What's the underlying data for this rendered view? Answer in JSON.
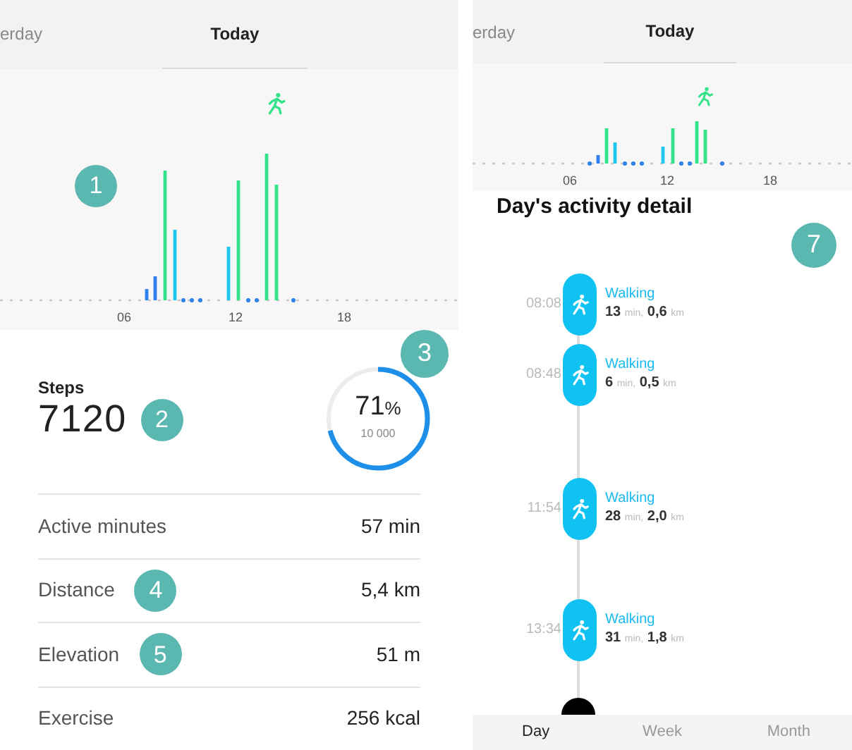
{
  "left": {
    "tabs": [
      {
        "label": "erday",
        "selected": false
      },
      {
        "label": "Today",
        "selected": true
      }
    ],
    "chart": {
      "axis_labels": [
        "06",
        "12",
        "18"
      ]
    },
    "badge_chart": "1",
    "steps": {
      "label": "Steps",
      "value": "7120",
      "badge": "2"
    },
    "goal": {
      "percent": "71",
      "unit": "%",
      "target": "10 000",
      "level": 0.71,
      "badge": "3"
    },
    "stats": [
      {
        "label": "Active minutes",
        "value": "57 min"
      },
      {
        "label": "Distance",
        "value": "5,4 km",
        "badge": "4"
      },
      {
        "label": "Elevation",
        "value": "51 m",
        "badge": "5"
      },
      {
        "label": "Exercise",
        "value": "256 kcal"
      }
    ]
  },
  "right": {
    "tabs": [
      {
        "label": "erday",
        "selected": false
      },
      {
        "label": "Today",
        "selected": true
      }
    ],
    "chart": {
      "axis_labels": [
        "06",
        "12",
        "18"
      ]
    },
    "title": "Day's activity detail",
    "badge": "7",
    "activities": [
      {
        "time": "08:08",
        "type": "Walking",
        "minutes": "13",
        "min_unit": "min,",
        "distance": "0,6",
        "km_unit": "km"
      },
      {
        "time": "08:48",
        "type": "Walking",
        "minutes": "6",
        "min_unit": "min,",
        "distance": "0,5",
        "km_unit": "km"
      },
      {
        "time": "11:54",
        "type": "Walking",
        "minutes": "28",
        "min_unit": "min,",
        "distance": "2,0",
        "km_unit": "km"
      },
      {
        "time": "13:34",
        "type": "Walking",
        "minutes": "31",
        "min_unit": "min,",
        "distance": "1,8",
        "km_unit": "km"
      }
    ],
    "bottom_tabs": [
      {
        "label": "Day",
        "selected": true
      },
      {
        "label": "Week",
        "selected": false
      },
      {
        "label": "Month",
        "selected": false
      }
    ]
  }
}
